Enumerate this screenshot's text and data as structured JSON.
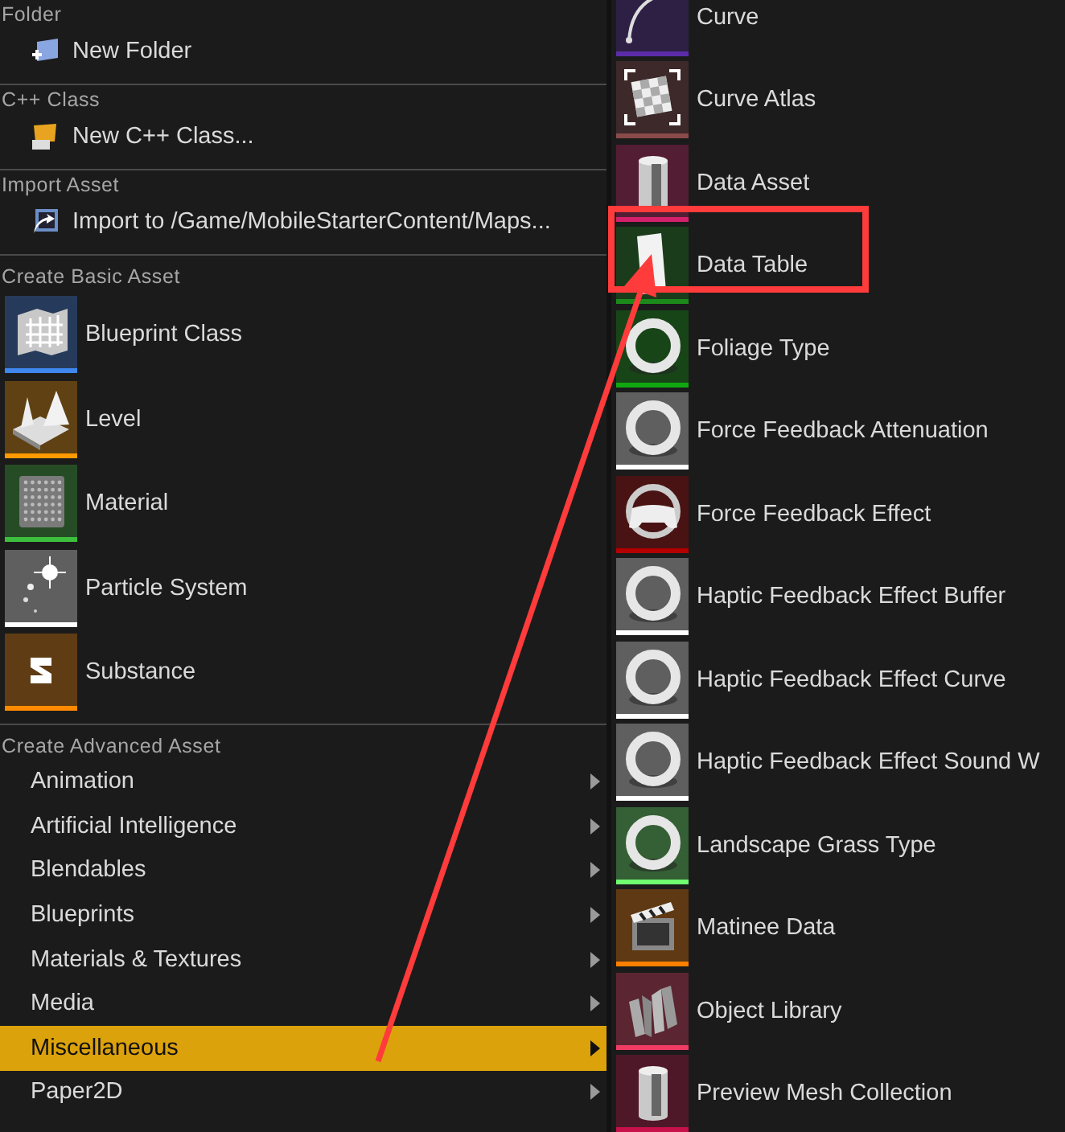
{
  "menu": {
    "sections": [
      {
        "heading": "Folder",
        "items": [
          {
            "label": "New Folder",
            "kind": "folder"
          }
        ]
      },
      {
        "heading": "C++ Class",
        "items": [
          {
            "label": "New C++ Class...",
            "kind": "cpp"
          }
        ]
      },
      {
        "heading": "Import Asset",
        "items": [
          {
            "label": "Import to /Game/MobileStarterContent/Maps...",
            "kind": "import"
          }
        ]
      }
    ],
    "basic_assets": {
      "heading": "Create Basic Asset",
      "items": [
        {
          "label": "Blueprint Class",
          "kind": "blueprint",
          "color": "#3f86ef"
        },
        {
          "label": "Level",
          "kind": "level",
          "color": "#ff9a00"
        },
        {
          "label": "Material",
          "kind": "material",
          "color": "#3cbf3c"
        },
        {
          "label": "Particle System",
          "kind": "particle",
          "color": "#ffffff"
        },
        {
          "label": "Substance",
          "kind": "substance",
          "color": "#ff8a00"
        }
      ]
    },
    "advanced_assets": {
      "heading": "Create Advanced Asset",
      "items": [
        {
          "label": "Animation",
          "submenu": true,
          "selected": false
        },
        {
          "label": "Artificial Intelligence",
          "submenu": true,
          "selected": false
        },
        {
          "label": "Blendables",
          "submenu": true,
          "selected": false
        },
        {
          "label": "Blueprints",
          "submenu": true,
          "selected": false
        },
        {
          "label": "Materials & Textures",
          "submenu": true,
          "selected": false
        },
        {
          "label": "Media",
          "submenu": true,
          "selected": false
        },
        {
          "label": "Miscellaneous",
          "submenu": true,
          "selected": true
        },
        {
          "label": "Paper2D",
          "submenu": true,
          "selected": false
        }
      ]
    }
  },
  "submenu": {
    "items": [
      {
        "label": "Curve",
        "kind": "curve",
        "color": "#5b2ca8"
      },
      {
        "label": "Curve Atlas",
        "kind": "atlas",
        "color": "#8b4a4a"
      },
      {
        "label": "Data Asset",
        "kind": "cylinder",
        "color": "#d4206a"
      },
      {
        "label": "Data Table",
        "kind": "table",
        "color": "#1b8a1b"
      },
      {
        "label": "Foliage Type",
        "kind": "ring",
        "color": "#10a810"
      },
      {
        "label": "Force Feedback Attenuation",
        "kind": "ring",
        "color": "#ffffff"
      },
      {
        "label": "Force Feedback Effect",
        "kind": "gamepad",
        "color": "#b40000"
      },
      {
        "label": "Haptic Feedback Effect Buffer",
        "kind": "ring",
        "color": "#ffffff"
      },
      {
        "label": "Haptic Feedback Effect Curve",
        "kind": "ring",
        "color": "#ffffff"
      },
      {
        "label": "Haptic Feedback Effect Sound W",
        "kind": "ring",
        "color": "#ffffff"
      },
      {
        "label": "Landscape Grass Type",
        "kind": "ring",
        "color": "#70ff70"
      },
      {
        "label": "Matinee Data",
        "kind": "clapper",
        "color": "#ff8000"
      },
      {
        "label": "Object Library",
        "kind": "books",
        "color": "#f03c64"
      },
      {
        "label": "Preview Mesh Collection",
        "kind": "cylinder",
        "color": "#c8104a"
      }
    ]
  }
}
